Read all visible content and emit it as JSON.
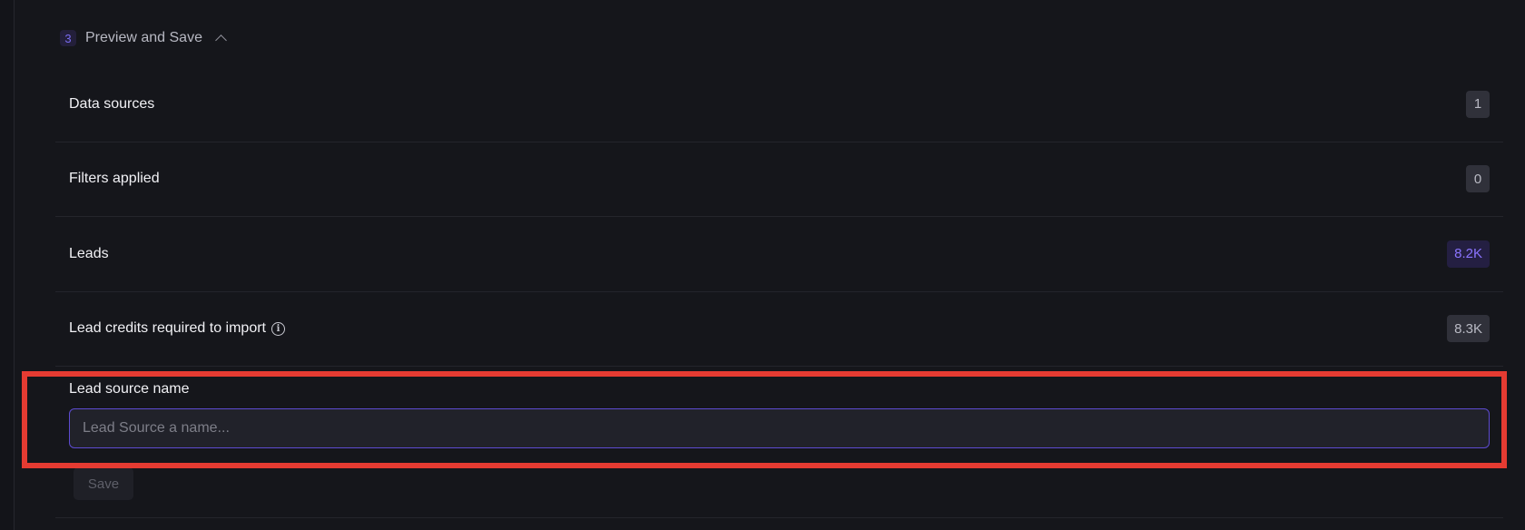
{
  "section": {
    "step_number": "3",
    "title": "Preview and Save"
  },
  "summary": [
    {
      "label": "Data sources",
      "value": "1",
      "accent": false,
      "info": false
    },
    {
      "label": "Filters applied",
      "value": "0",
      "accent": false,
      "info": false
    },
    {
      "label": "Leads",
      "value": "8.2K",
      "accent": true,
      "info": false
    },
    {
      "label": "Lead credits required to import",
      "value": "8.3K",
      "accent": false,
      "info": true
    }
  ],
  "lead_source": {
    "label": "Lead source name",
    "placeholder": "Lead Source a name...",
    "value": ""
  },
  "actions": {
    "save_label": "Save"
  },
  "colors": {
    "accent": "#8b74ff",
    "highlight": "#e53b32",
    "background": "#15161b"
  },
  "icons": {
    "collapse": "chevron-up-icon",
    "info": "info-icon"
  }
}
